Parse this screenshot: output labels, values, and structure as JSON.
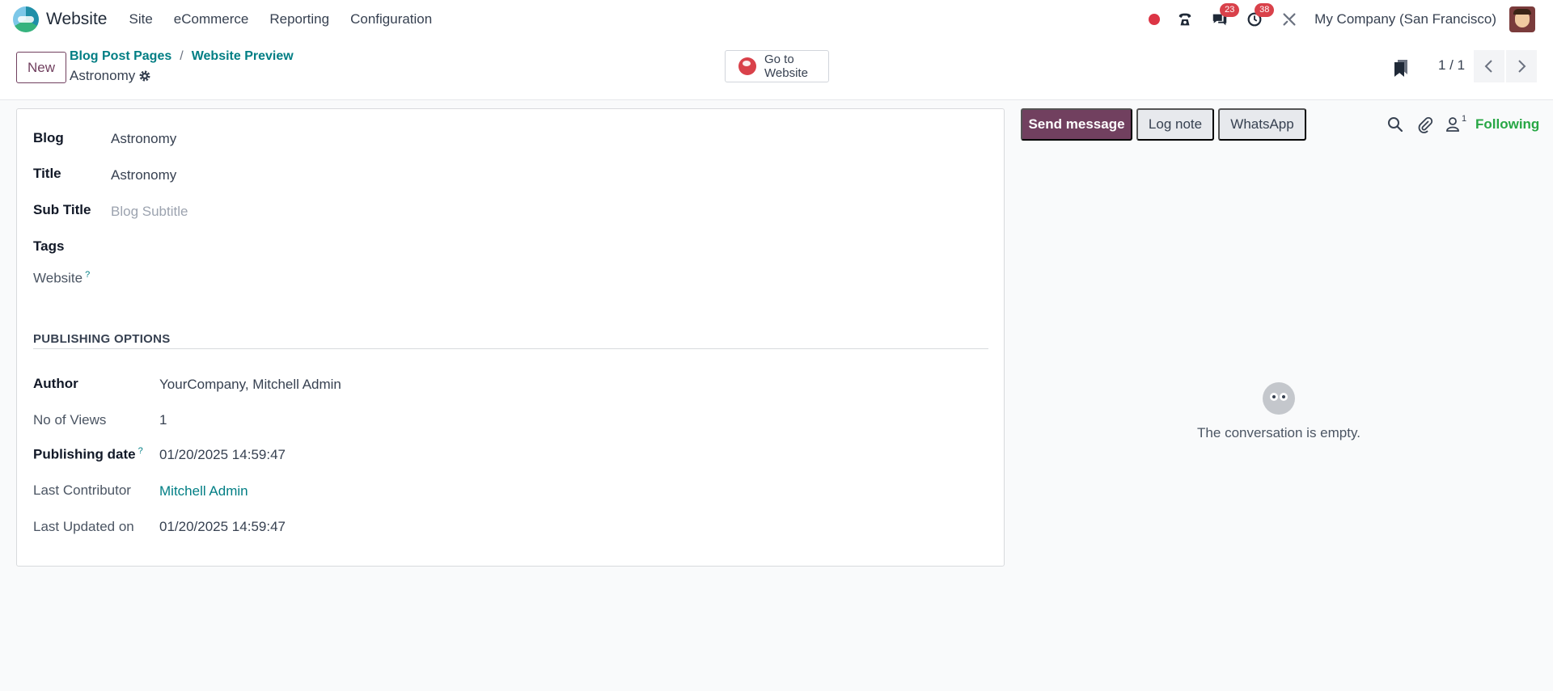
{
  "navbar": {
    "app_name": "Website",
    "menu": [
      "Site",
      "eCommerce",
      "Reporting",
      "Configuration"
    ],
    "messages_count": "23",
    "activities_count": "38",
    "company": "My Company (San Francisco)"
  },
  "control_panel": {
    "new_label": "New",
    "breadcrumb": [
      "Blog Post Pages",
      "Website Preview"
    ],
    "breadcrumb_separator": "/",
    "record_name": "Astronomy",
    "goto_label": "Go to Website",
    "pager": "1 / 1"
  },
  "form": {
    "blog_label": "Blog",
    "blog_value": "Astronomy",
    "title_label": "Title",
    "title_value": "Astronomy",
    "subtitle_label": "Sub Title",
    "subtitle_placeholder": "Blog Subtitle",
    "tags_label": "Tags",
    "website_label": "Website",
    "help_mark": "?",
    "section_title": "PUBLISHING OPTIONS",
    "author_label": "Author",
    "author_value": "YourCompany, Mitchell Admin",
    "views_label": "No of Views",
    "views_value": "1",
    "pubdate_label": "Publishing date",
    "pubdate_value": "01/20/2025 14:59:47",
    "contributor_label": "Last Contributor",
    "contributor_value": "Mitchell Admin",
    "updated_label": "Last Updated on",
    "updated_value": "01/20/2025 14:59:47"
  },
  "chatter": {
    "send_message": "Send message",
    "log_note": "Log note",
    "whatsapp": "WhatsApp",
    "followers_count": "1",
    "following": "Following",
    "empty_text": "The conversation is empty."
  },
  "colors": {
    "primary": "#71405f",
    "link": "#017e84",
    "following": "#28a745",
    "badge": "#d9414a"
  }
}
